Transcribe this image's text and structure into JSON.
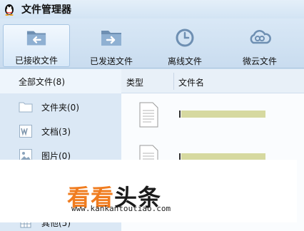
{
  "app": {
    "title": "文件管理器",
    "logo_icon": "qq-penguin-icon"
  },
  "toolbar": {
    "buttons": [
      {
        "label": "已接收文件",
        "icon": "received-folder-icon",
        "active": true
      },
      {
        "label": "已发送文件",
        "icon": "sent-folder-icon",
        "active": false
      },
      {
        "label": "离线文件",
        "icon": "offline-clock-icon",
        "active": false
      },
      {
        "label": "微云文件",
        "icon": "weiyun-cloud-icon",
        "active": false
      }
    ]
  },
  "sidebar": {
    "all_files": "全部文件(8)",
    "items": [
      {
        "label": "文件夹(0)",
        "icon": "folder-icon"
      },
      {
        "label": "文档(3)",
        "icon": "word-doc-icon"
      },
      {
        "label": "图片(0)",
        "icon": "image-icon"
      },
      {
        "label": "其他(5)",
        "icon": "grid-icon"
      }
    ]
  },
  "file_list": {
    "columns": [
      "类型",
      "文件名"
    ],
    "rows": [
      {
        "type_icon": "document-icon"
      },
      {
        "type_icon": "document-icon"
      }
    ]
  },
  "watermark": {
    "brand_part1": "看看",
    "brand_part2": "头条",
    "url": "www.kankantoutiao.com",
    "colors": {
      "orange": "#f07c1f",
      "dark": "#1a1a1a"
    }
  }
}
